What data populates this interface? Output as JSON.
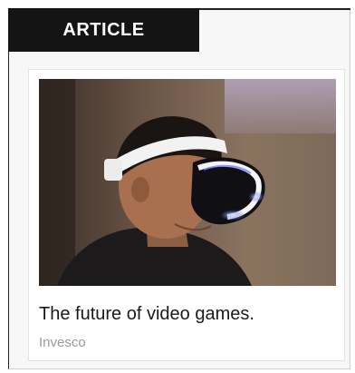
{
  "label": "ARTICLE",
  "card": {
    "title": "The future of video games.",
    "source": "Invesco",
    "image": "person-wearing-vr-headset-photo"
  },
  "colors": {
    "label_bg": "#141414",
    "label_text": "#ffffff",
    "title_text": "#1a1a1a",
    "source_text": "#9a9a9a"
  }
}
